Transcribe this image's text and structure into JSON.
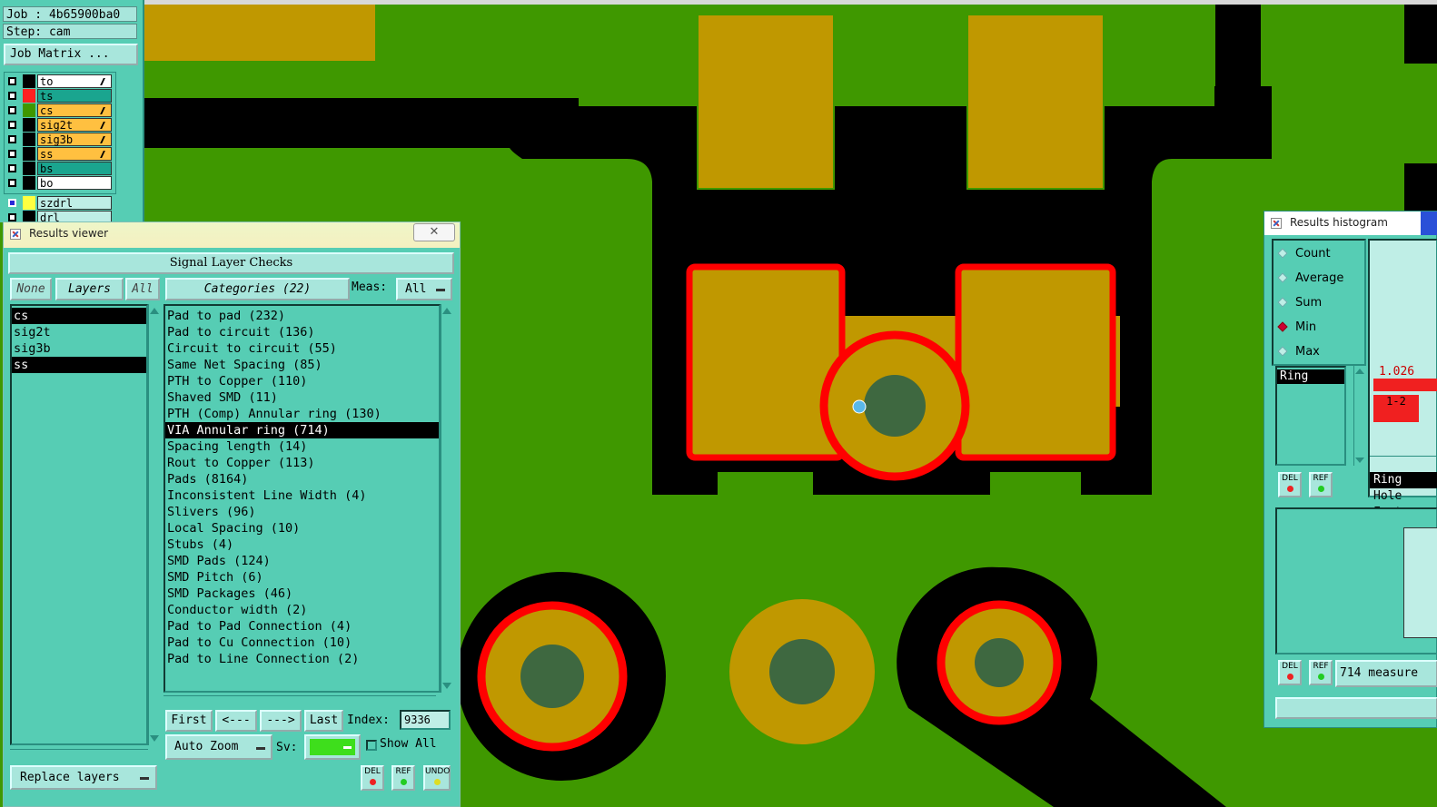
{
  "job_panel": {
    "job_label": "Job : 4b65900ba0",
    "step_label": "Step: cam",
    "job_matrix_button": "Job Matrix ..."
  },
  "layers": [
    {
      "name": "to",
      "swatch": "#000000",
      "color": "#ffffff"
    },
    {
      "name": "ts",
      "swatch": "#ff2020",
      "color": "#1aa58f"
    },
    {
      "name": "cs",
      "swatch": "#3f9800",
      "color": "#ffc040"
    },
    {
      "name": "sig2t",
      "swatch": "#000000",
      "color": "#ffc040"
    },
    {
      "name": "sig3b",
      "swatch": "#000000",
      "color": "#ffc040"
    },
    {
      "name": "ss",
      "swatch": "#000000",
      "color": "#ffc040"
    },
    {
      "name": "bs",
      "swatch": "#000000",
      "color": "#1aa58f"
    },
    {
      "name": "bo",
      "swatch": "#000000",
      "color": "#ffffff"
    }
  ],
  "drill_layers": [
    {
      "name": "szdrl",
      "swatch": "#ffff40",
      "color": "#bfeee6"
    },
    {
      "name": "drl",
      "swatch": "#000000",
      "color": "#bfeee6"
    }
  ],
  "results_viewer": {
    "title": "Results viewer",
    "close_icon": "✕",
    "header": "Signal Layer Checks",
    "filter_none": "None",
    "filter_layers": "Layers",
    "filter_all": "All",
    "categories_button": "Categories (22)",
    "meas_label": "Meas:",
    "meas_value": "All",
    "layer_list": [
      "cs",
      "sig2t",
      "sig3b",
      "ss"
    ],
    "categories": [
      "Pad to pad (232)",
      "Pad to circuit (136)",
      "Circuit to circuit (55)",
      "Same Net Spacing (85)",
      "PTH to Copper (110)",
      "Shaved SMD (11)",
      "PTH (Comp) Annular ring (130)",
      "VIA Annular ring (714)",
      "Spacing length (14)",
      "Rout to Copper (113)",
      "Pads (8164)",
      "Inconsistent Line Width (4)",
      "Slivers (96)",
      "Local Spacing (10)",
      "Stubs (4)",
      "SMD Pads (124)",
      "SMD Pitch (6)",
      "SMD Packages (46)",
      "Conductor width (2)",
      "Pad to Pad Connection (4)",
      "Pad to Cu Connection (10)",
      "Pad to Line Connection (2)"
    ],
    "nav": {
      "first": "First",
      "prev": "<---",
      "next": "--->",
      "last": "Last",
      "index_label": "Index:",
      "index_value": "9336"
    },
    "auto_zoom": "Auto Zoom",
    "sv_label": "Sv:",
    "show_all": "Show All",
    "replace_layers": "Replace layers",
    "del": "DEL",
    "ref": "REF",
    "undo": "UNDO"
  },
  "results_histogram": {
    "title": "Results histogram",
    "modes": [
      "Count",
      "Average",
      "Sum",
      "Min",
      "Max"
    ],
    "selected_mode": "Min",
    "list": [
      "Ring"
    ],
    "bar_value": "1.026",
    "bin_label": "1-2",
    "attrs": [
      "Ring",
      "Hole",
      "Featur"
    ],
    "measure_text": "714 measure",
    "del": "DEL",
    "ref": "REF"
  },
  "colors": {
    "board": "#3f9800",
    "copper": "#c09800",
    "violation": "#ff0000",
    "drill": "#3e6840",
    "clearance": "#000000"
  }
}
